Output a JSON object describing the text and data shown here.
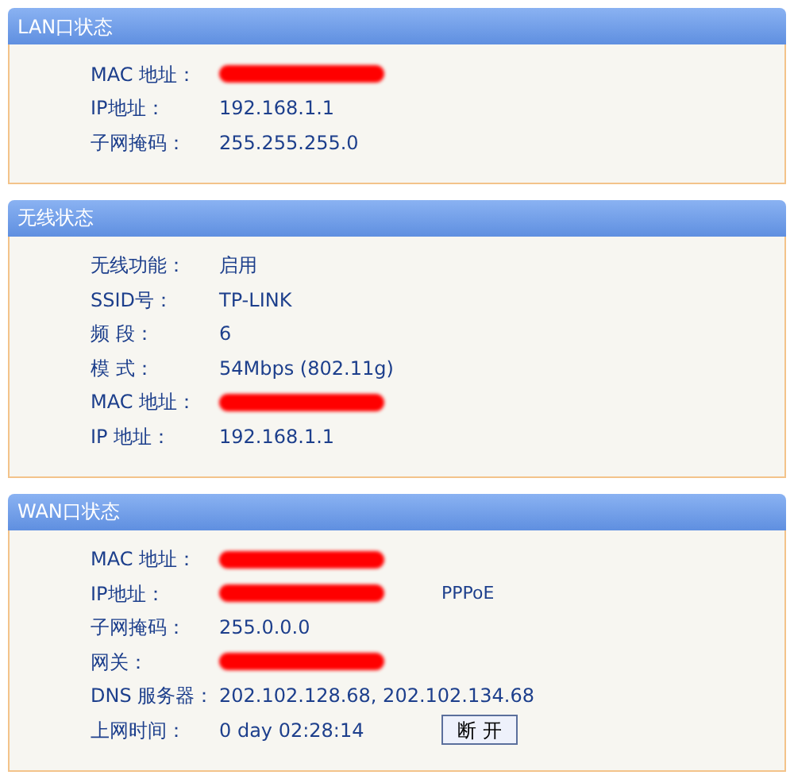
{
  "sections": [
    {
      "title": "LAN口状态",
      "rows": [
        {
          "label": "MAC 地址：",
          "kind": "redacted"
        },
        {
          "label": "IP地址：",
          "kind": "text",
          "value": "192.168.1.1"
        },
        {
          "label": "子网掩码：",
          "kind": "text",
          "value": "255.255.255.0"
        }
      ]
    },
    {
      "title": "无线状态",
      "rows": [
        {
          "label": "无线功能：",
          "kind": "text",
          "value": "启用"
        },
        {
          "label": "SSID号：",
          "kind": "text",
          "value": "TP-LINK"
        },
        {
          "label": "频 段：",
          "kind": "text",
          "value": "6"
        },
        {
          "label": "模 式：",
          "kind": "text",
          "value": "54Mbps (802.11g)"
        },
        {
          "label": "MAC 地址：",
          "kind": "redacted"
        },
        {
          "label": "IP 地址：",
          "kind": "text",
          "value": "192.168.1.1"
        }
      ]
    },
    {
      "title": "WAN口状态",
      "rows": [
        {
          "label": "MAC 地址：",
          "kind": "redacted"
        },
        {
          "label": "IP地址：",
          "kind": "redacted",
          "extra": "PPPoE"
        },
        {
          "label": "子网掩码：",
          "kind": "text",
          "value": "255.0.0.0"
        },
        {
          "label": "网关：",
          "kind": "redacted"
        },
        {
          "label": "DNS 服务器：",
          "kind": "text",
          "value": "202.102.128.68, 202.102.134.68"
        },
        {
          "label": "上网时间：",
          "kind": "text",
          "value": "0 day 02:28:14",
          "button": "断 开"
        }
      ]
    }
  ]
}
